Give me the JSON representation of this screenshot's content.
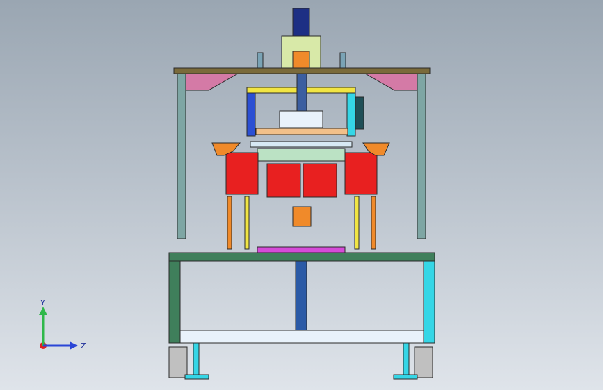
{
  "viewport": {
    "background_top": "#9aa6b2",
    "background_bottom": "#dfe4ea"
  },
  "model": {
    "colors": {
      "frame_outline": "#2a2a2a",
      "base_green": "#3f7f5b",
      "top_plate": "#7a6a3a",
      "cyan_leg": "#35d6e6",
      "blue_bracket": "#2b4fd3",
      "yellow_beam": "#f1e543",
      "red_panel": "#e82020",
      "orange_rod": "#f08a2a",
      "pink_gusset": "#d47aa6",
      "magenta_plate": "#d54bd8",
      "motor_navy": "#1d2f84",
      "light_rail": "#d7e9f4"
    }
  },
  "triad": {
    "y_label": "Y",
    "z_label": "Z",
    "y_color": "#2fb84a",
    "z_color": "#2a45d6",
    "origin_color": "#e02020"
  }
}
